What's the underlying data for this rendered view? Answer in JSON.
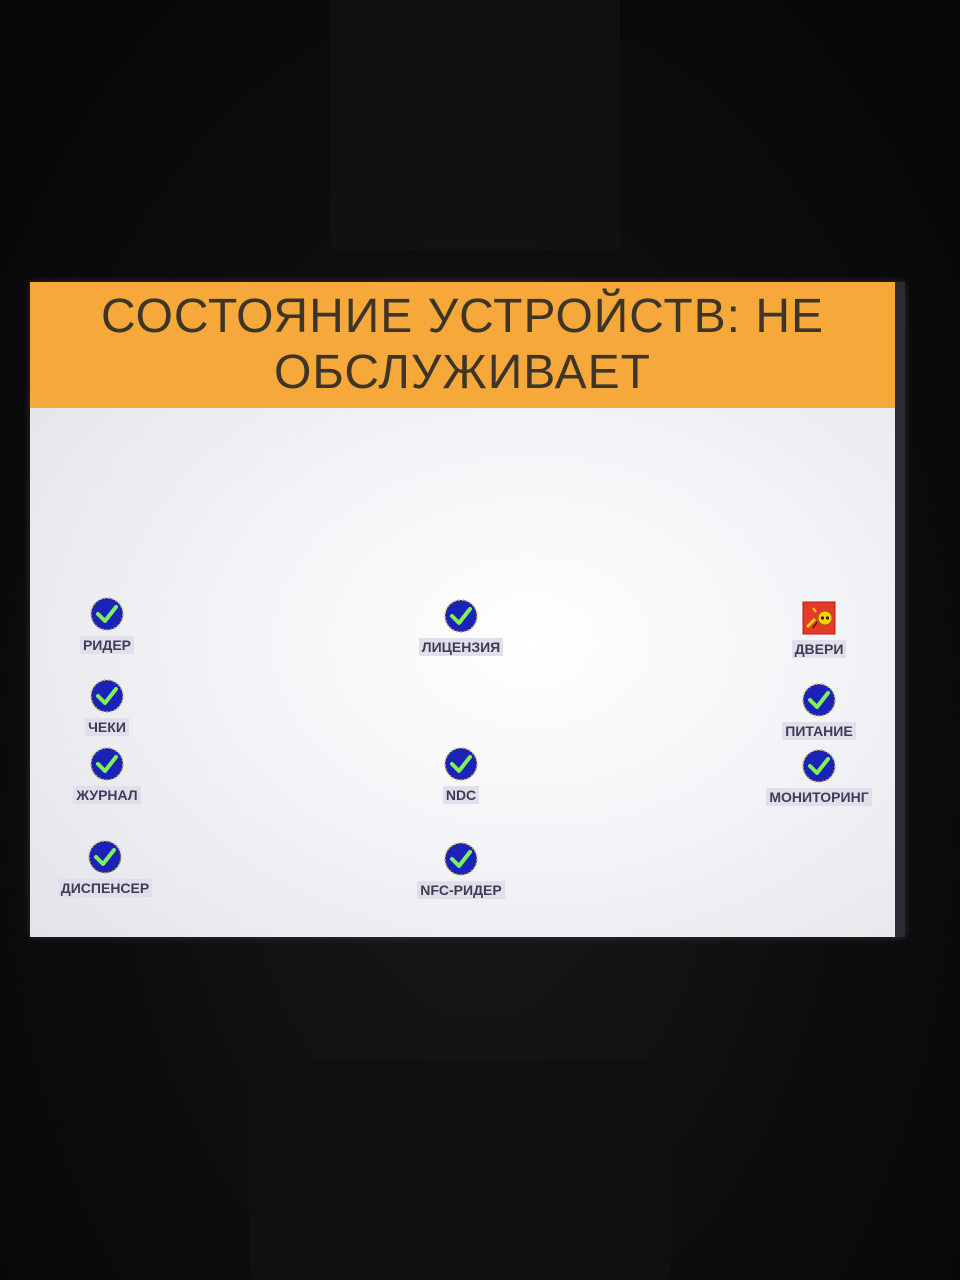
{
  "header": {
    "title": "СОСТОЯНИЕ УСТРОЙСТВ:  НЕ ОБСЛУЖИВАЕТ"
  },
  "devices": [
    {
      "label": "РИДЕР",
      "status": "ok",
      "icon": "check-icon"
    },
    {
      "label": "ЛИЦЕНЗИЯ",
      "status": "ok",
      "icon": "check-icon"
    },
    {
      "label": "ДВЕРИ",
      "status": "alert",
      "icon": "door-alert-icon"
    },
    {
      "label": "ЧЕКИ",
      "status": "ok",
      "icon": "check-icon"
    },
    {
      "label": "ПИТАНИЕ",
      "status": "ok",
      "icon": "check-icon"
    },
    {
      "label": "ЖУРНАЛ",
      "status": "ok",
      "icon": "check-icon"
    },
    {
      "label": "NDC",
      "status": "ok",
      "icon": "check-icon"
    },
    {
      "label": "МОНИТОРИНГ",
      "status": "ok",
      "icon": "check-icon"
    },
    {
      "label": "ДИСПЕНСЕР",
      "status": "ok",
      "icon": "check-icon"
    },
    {
      "label": "NFC-РИДЕР",
      "status": "ok",
      "icon": "check-icon"
    }
  ],
  "colors": {
    "header": "#f6a93a",
    "ok_circle": "#1a22b8",
    "ok_check": "#7ef05a",
    "alert_box": "#e53a2a",
    "alert_symbol": "#f5d400"
  }
}
